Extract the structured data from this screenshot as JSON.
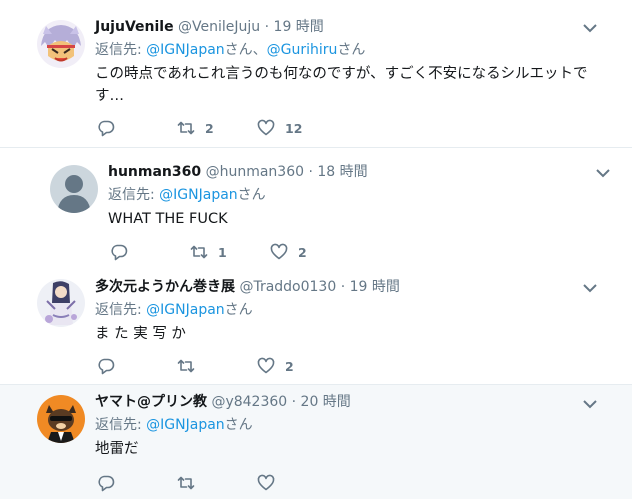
{
  "tweets": [
    {
      "name": "JujuVenile",
      "handle": "@VenileJuju",
      "dot": "·",
      "time": "19 時間",
      "reply_prefix": "返信先: ",
      "mentions": [
        "@IGNJapan",
        "@Gurihiru"
      ],
      "mention_suffixes": [
        "さん、",
        "さん"
      ],
      "text": "この時点であれこれ言うのも何なのですが、すごく不安になるシルエットです…",
      "reply_count": "",
      "retweet_count": "2",
      "like_count": "12"
    },
    {
      "name": "hunman360",
      "handle": "@hunman360",
      "dot": "·",
      "time": "18 時間",
      "reply_prefix": "返信先: ",
      "mentions": [
        "@IGNJapan"
      ],
      "mention_suffixes": [
        "さん"
      ],
      "text": "WHAT THE FUCK",
      "reply_count": "",
      "retweet_count": "1",
      "like_count": "2"
    },
    {
      "name": "多次元ようかん巻き展",
      "handle": "@Traddo0130",
      "dot": "·",
      "time": "19 時間",
      "reply_prefix": "返信先: ",
      "mentions": [
        "@IGNJapan"
      ],
      "mention_suffixes": [
        "さん"
      ],
      "text": "ま た 実 写 か",
      "reply_count": "",
      "retweet_count": "",
      "like_count": "2"
    },
    {
      "name": "ヤマト@プリン教",
      "handle": "@y842360",
      "dot": "·",
      "time": "20 時間",
      "reply_prefix": "返信先: ",
      "mentions": [
        "@IGNJapan"
      ],
      "mention_suffixes": [
        "さん"
      ],
      "text": "地雷だ",
      "reply_count": "",
      "retweet_count": "",
      "like_count": ""
    }
  ],
  "icons": {
    "reply": "reply-icon",
    "retweet": "retweet-icon",
    "like": "heart-icon",
    "more": "chevron-down-icon"
  },
  "colors": {
    "link": "#1b95e0",
    "secondary_text": "#657786",
    "icon": "#657786",
    "divider": "#e6ecf0",
    "highlight_bg": "#f5f8fa"
  }
}
